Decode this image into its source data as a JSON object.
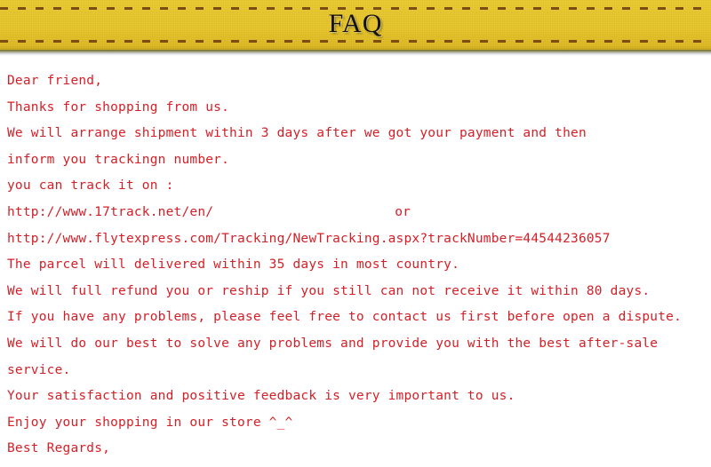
{
  "banner": {
    "title": "FAQ",
    "background_color": "#e7c527",
    "stitch_color": "#7a4d10",
    "title_color": "#14110a"
  },
  "letter": {
    "text_color": "#d51f26",
    "lines": [
      "Dear friend,",
      "Thanks for shopping from us.",
      "We will arrange shipment within 3 days after we got your payment and then",
      "inform you trackingn number.",
      "you can track it on :",
      "http://www.17track.net/en/",
      "http://www.flytexpress.com/Tracking/NewTracking.aspx?trackNumber=44544236057",
      "The parcel will delivered within 35 days in most country.",
      "We will full refund you or reship if you still can not receive it within 80 days.",
      "If you have any problems, please feel free to contact us first before open a dispute.",
      "We will do our best to solve any problems and provide you with the best after-sale",
      "service.",
      "Your satisfaction and positive feedback is very important to us.",
      "Enjoy your shopping in our store ^_^",
      "Best Regards,"
    ],
    "tracking_line_suffix": "or",
    "tracking_number": "44544236057",
    "track_url_1": "http://www.17track.net/en/",
    "track_url_2": "http://www.flytexpress.com/Tracking/NewTracking.aspx?trackNumber=44544236057"
  }
}
